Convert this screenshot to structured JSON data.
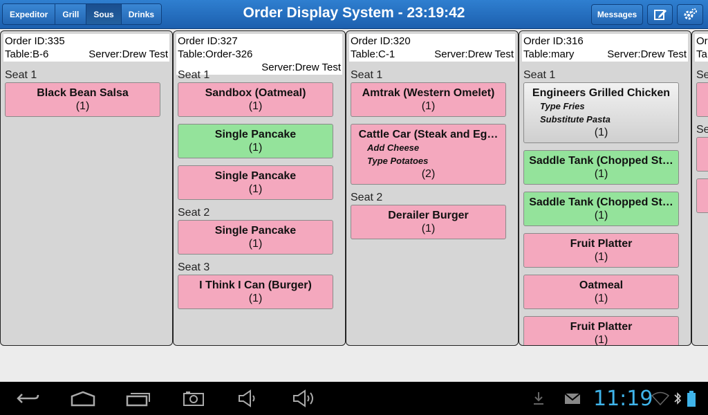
{
  "topbar": {
    "stations": [
      "Expeditor",
      "Grill",
      "Sous",
      "Drinks"
    ],
    "active_station": "Sous",
    "title": "Order Display System - 23:19:42",
    "messages_label": "Messages"
  },
  "orders": [
    {
      "id_label": "Order ID:335",
      "table_label": "Table:B-6",
      "server_label": "Server:Drew Test",
      "seats": [
        {
          "label": "Seat 1",
          "items": [
            {
              "name": "Black Bean Salsa",
              "qty": "(1)",
              "color": "pink",
              "mods": []
            }
          ]
        }
      ]
    },
    {
      "id_label": "Order ID:327",
      "table_label": "Table:Order-326",
      "server_label": "Server:Drew Test",
      "seats": [
        {
          "label": "Seat 1",
          "items": [
            {
              "name": "Sandbox (Oatmeal)",
              "qty": "(1)",
              "color": "pink",
              "mods": []
            },
            {
              "name": "Single Pancake",
              "qty": "(1)",
              "color": "green",
              "mods": []
            },
            {
              "name": "Single Pancake",
              "qty": "(1)",
              "color": "pink",
              "mods": []
            }
          ]
        },
        {
          "label": "Seat 2",
          "items": [
            {
              "name": "Single Pancake",
              "qty": "(1)",
              "color": "pink",
              "mods": []
            }
          ]
        },
        {
          "label": "Seat 3",
          "items": [
            {
              "name": "I Think I Can (Burger)",
              "qty": "(1)",
              "color": "pink",
              "mods": []
            }
          ]
        }
      ]
    },
    {
      "id_label": "Order ID:320",
      "table_label": "Table:C-1",
      "server_label": "Server:Drew Test",
      "seats": [
        {
          "label": "Seat 1",
          "items": [
            {
              "name": "Amtrak (Western Omelet)",
              "qty": "(1)",
              "color": "pink",
              "mods": []
            },
            {
              "name": "Cattle Car (Steak and Eg…",
              "qty": "(2)",
              "color": "pink",
              "mods": [
                "Add Cheese",
                "Type Potatoes"
              ]
            }
          ]
        },
        {
          "label": "Seat 2",
          "items": [
            {
              "name": "Derailer Burger",
              "qty": "(1)",
              "color": "pink",
              "mods": []
            }
          ]
        }
      ]
    },
    {
      "id_label": "Order ID:316",
      "table_label": "Table:mary",
      "server_label": "Server:Drew Test",
      "seats": [
        {
          "label": "Seat 1",
          "items": [
            {
              "name": "Engineers Grilled Chicken",
              "qty": "(1)",
              "color": "gray",
              "mods": [
                "Type Fries",
                "Substitute Pasta"
              ]
            },
            {
              "name": "Saddle Tank (Chopped St…",
              "qty": "(1)",
              "color": "green",
              "mods": []
            },
            {
              "name": "Saddle Tank (Chopped St…",
              "qty": "(1)",
              "color": "green",
              "mods": []
            },
            {
              "name": "Fruit Platter",
              "qty": "(1)",
              "color": "pink",
              "mods": []
            },
            {
              "name": "Oatmeal",
              "qty": "(1)",
              "color": "pink",
              "mods": []
            },
            {
              "name": "Fruit Platter",
              "qty": "(1)",
              "color": "pink",
              "mods": []
            }
          ]
        }
      ]
    },
    {
      "id_label": "Ord",
      "table_label": "Ta",
      "server_label": "",
      "seats": [
        {
          "label": "Se",
          "items": [
            {
              "name": "",
              "qty": "",
              "color": "pink",
              "mods": []
            }
          ]
        },
        {
          "label": "Se",
          "items": [
            {
              "name": "",
              "qty": "",
              "color": "pink",
              "mods": []
            },
            {
              "name": "S",
              "qty": "",
              "color": "pink",
              "mods": []
            }
          ]
        }
      ]
    }
  ],
  "statusbar": {
    "clock": "11:19"
  },
  "colors": {
    "topbar": "#1c5fae",
    "item_pink": "#f4a8be",
    "item_green": "#94e39b",
    "clock": "#3fb4ea"
  },
  "icons": [
    "back-icon",
    "home-icon",
    "recent-apps-icon",
    "screenshot-icon",
    "volume-down-icon",
    "volume-up-icon",
    "download-icon",
    "mail-icon",
    "wifi-icon",
    "bluetooth-icon",
    "battery-icon",
    "edit-icon",
    "gear-icon"
  ]
}
